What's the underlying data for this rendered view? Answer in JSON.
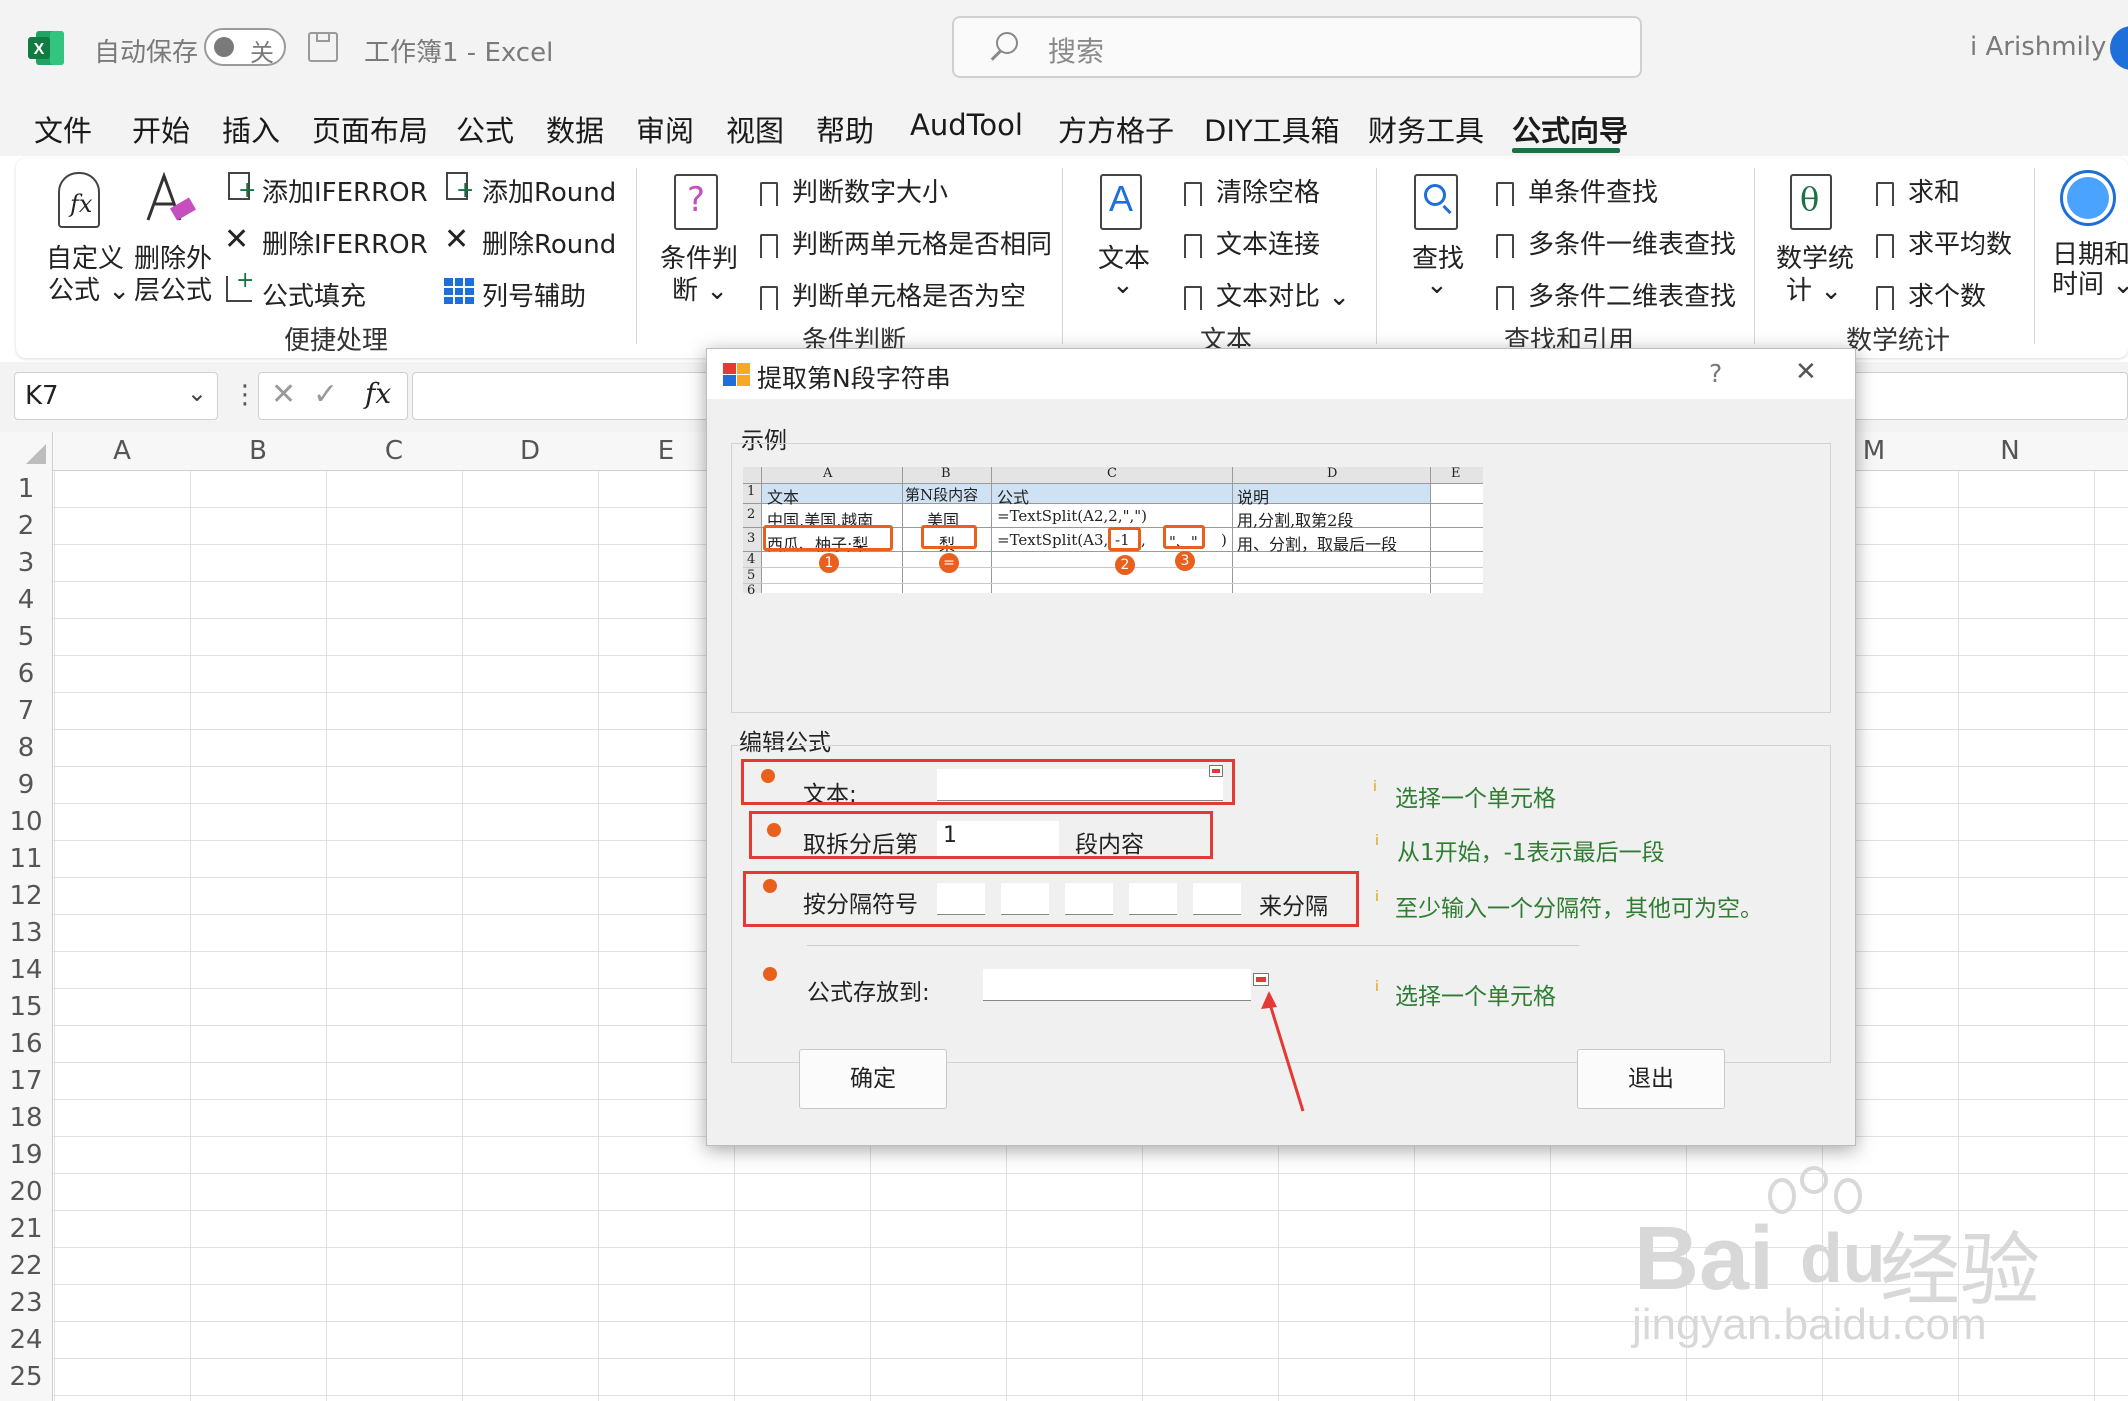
{
  "titlebar": {
    "autosave_label": "自动保存",
    "toggle_state": "关",
    "doc_title": "工作簿1  -  Excel",
    "search_placeholder": "搜索",
    "user_name": "i Arishmily"
  },
  "menu": [
    "文件",
    "开始",
    "插入",
    "页面布局",
    "公式",
    "数据",
    "审阅",
    "视图",
    "帮助",
    "AudTool",
    "方方格子",
    "DIY工具箱",
    "财务工具",
    "公式向导"
  ],
  "menu_active": "公式向导",
  "ribbon": {
    "quick": {
      "big1_line1": "自定义",
      "big1_line2": "公式 ⌄",
      "big2_line1": "删除外",
      "big2_line2": "层公式",
      "items": [
        "添加IFERROR",
        "删除IFERROR",
        "公式填充",
        "添加Round",
        "删除Round",
        "列号辅助"
      ],
      "group": "便捷处理"
    },
    "cond": {
      "big_line1": "条件判",
      "big_line2": "断 ⌄",
      "items": [
        "判断数字大小",
        "判断两单元格是否相同",
        "判断单元格是否为空"
      ],
      "group": "条件判断"
    },
    "text": {
      "big_line1": "文本",
      "big_line2": "⌄",
      "items": [
        "清除空格",
        "文本连接",
        "文本对比  ⌄"
      ],
      "group": "文本"
    },
    "lookup": {
      "big_line1": "查找",
      "big_line2": "⌄",
      "items": [
        "单条件查找",
        "多条件一维表查找",
        "多条件二维表查找"
      ],
      "group": "查找和引用"
    },
    "math": {
      "big_line1": "数学统",
      "big_line2": "计 ⌄",
      "items": [
        "求和",
        "求平均数",
        "求个数"
      ],
      "group": "数学统计"
    },
    "date": {
      "big_line1": "日期和",
      "big_line2": "时间 ⌄"
    }
  },
  "formula_bar": {
    "cell_ref": "K7",
    "fx": "fx"
  },
  "grid": {
    "columns_left": [
      "A",
      "B",
      "C",
      "D",
      "E"
    ],
    "columns_right": [
      "M",
      "N"
    ],
    "rows": [
      "1",
      "2",
      "3",
      "4",
      "5",
      "6",
      "7",
      "8",
      "9",
      "10",
      "11",
      "12",
      "13",
      "14",
      "15",
      "16",
      "17",
      "18",
      "19",
      "20",
      "21",
      "22",
      "23",
      "24",
      "25"
    ]
  },
  "dialog": {
    "title": "提取第N段字符串",
    "help": "?",
    "close": "✕",
    "example_legend": "示例",
    "edit_legend": "编辑公式",
    "example": {
      "col_headers": [
        "A",
        "B",
        "C",
        "D",
        "E"
      ],
      "row_numbers": [
        "1",
        "2",
        "3",
        "4",
        "5",
        "6"
      ],
      "row1": [
        "文本",
        "第N段内容",
        "公式",
        "说明"
      ],
      "row2": [
        "中国,美国,越南",
        "美国",
        "=TextSplit(A2,2,\",\")",
        "用,分割,取第2段"
      ],
      "row3_a": "西瓜、柚子;梨",
      "row3_b": "梨",
      "row3_c1": "=TextSplit(A3,",
      "row3_c2": "-1",
      "row3_c3": ",",
      "row3_c4": "\"、\"",
      "row3_c5": ")",
      "row3_d": "用、分割，取最后一段",
      "markers": [
        "1",
        "=",
        "2",
        "3"
      ]
    },
    "text_label": "文本:",
    "text_value": "",
    "nth_label": "取拆分后第",
    "nth_value": "1",
    "nth_suffix": "段内容",
    "sep_label": "按分隔符号",
    "sep_values": [
      "",
      "",
      "",
      "",
      ""
    ],
    "sep_suffix": "来分隔",
    "dest_label": "公式存放到:",
    "dest_value": "",
    "hint_text": "选择一个单元格",
    "hint_nth": "从1开始，-1表示最后一段",
    "hint_sep": "至少输入一个分隔符，其他可为空。",
    "hint_dest": "选择一个单元格",
    "ok": "确定",
    "exit": "退出"
  },
  "watermark": {
    "brand": "Bai",
    "brand2": "du",
    "cn": "经验",
    "url": "jingyan.baidu.com"
  },
  "colors": {
    "excel_green": "#1e7145",
    "accent_orange": "#e8601c",
    "red_box": "#e53935",
    "hint_green": "#2e7d32"
  }
}
